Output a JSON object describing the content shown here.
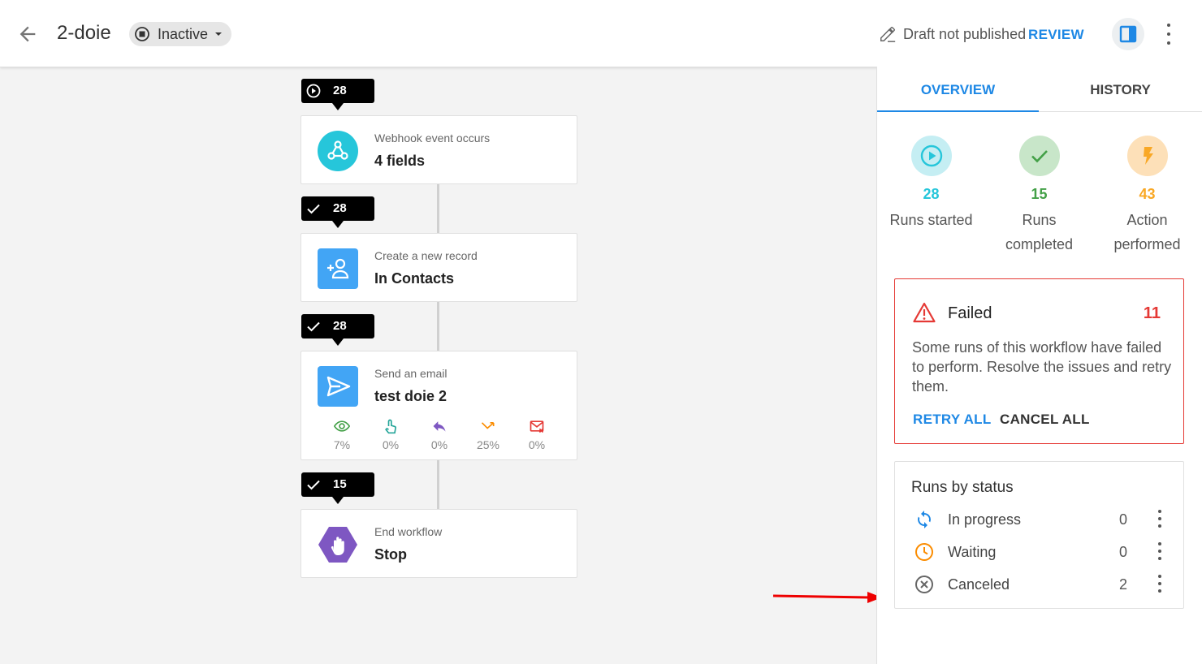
{
  "header": {
    "title": "2-doie",
    "status": "Inactive",
    "draft_text": "Draft not published",
    "review_label": "REVIEW"
  },
  "workflow": {
    "steps": [
      {
        "badge_icon": "play-circle-icon",
        "badge_count": "28",
        "subtitle": "Webhook event occurs",
        "title": "4 fields",
        "icon": "webhook-icon",
        "icon_color": "#26c6da"
      },
      {
        "badge_icon": "check-icon",
        "badge_count": "28",
        "subtitle": "Create a new record",
        "title": "In Contacts",
        "icon": "add-contact-icon",
        "icon_color": "#42a5f5"
      },
      {
        "badge_icon": "check-icon",
        "badge_count": "28",
        "subtitle": "Send an email",
        "title": "test doie 2",
        "icon": "send-icon",
        "icon_color": "#42a5f5",
        "stats": [
          {
            "icon": "eye-icon",
            "value": "7%",
            "color": "#43a047"
          },
          {
            "icon": "touch-icon",
            "value": "0%",
            "color": "#26a69a"
          },
          {
            "icon": "reply-icon",
            "value": "0%",
            "color": "#7e57c2"
          },
          {
            "icon": "bounce-icon",
            "value": "25%",
            "color": "#fb8c00"
          },
          {
            "icon": "unsubscribe-mail-icon",
            "value": "0%",
            "color": "#e53935"
          }
        ]
      },
      {
        "badge_icon": "check-icon",
        "badge_count": "15",
        "subtitle": "End workflow",
        "title": "Stop",
        "icon": "stop-hand-icon",
        "icon_color": "#7e57c2"
      }
    ]
  },
  "side": {
    "tabs": {
      "overview": "OVERVIEW",
      "history": "HISTORY"
    },
    "kpis": [
      {
        "value": "28",
        "label_line1": "Runs started",
        "label_line2": "",
        "color": "#26c6da"
      },
      {
        "value": "15",
        "label_line1": "Runs",
        "label_line2": "completed",
        "color": "#43a047"
      },
      {
        "value": "43",
        "label_line1": "Action",
        "label_line2": "performed",
        "color": "#f9a825"
      }
    ],
    "failed": {
      "title": "Failed",
      "count": "11",
      "description": "Some runs of this workflow have failed to perform. Resolve the issues and retry them.",
      "retry_label": "RETRY ALL",
      "cancel_label": "CANCEL ALL"
    },
    "runs_by_status": {
      "title": "Runs by status",
      "rows": [
        {
          "label": "In progress",
          "count": "0",
          "icon": "sync-icon",
          "color": "#1e88e5"
        },
        {
          "label": "Waiting",
          "count": "0",
          "icon": "clock-icon",
          "color": "#fb8c00"
        },
        {
          "label": "Canceled",
          "count": "2",
          "icon": "cancel-circle-icon",
          "color": "#666666"
        }
      ]
    }
  }
}
